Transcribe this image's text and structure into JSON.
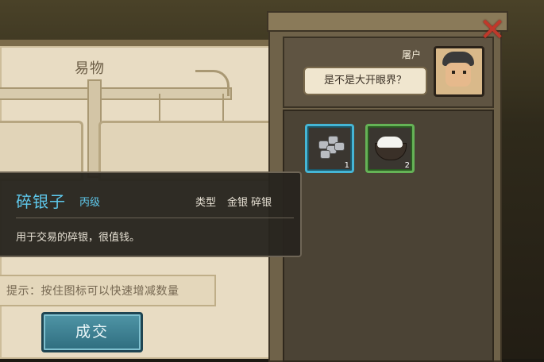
{
  "trade_panel": {
    "title": "易物",
    "hint": "提示：按住图标可以快速增减数量",
    "deal_button_label": "成交"
  },
  "shop": {
    "speaker_name": "屠户",
    "speech": "是不是大开眼界？",
    "slots": [
      {
        "item": "silver-icon",
        "count": "1",
        "border_color": "#45b6d6"
      },
      {
        "item": "rice-bowl-icon",
        "count": "2",
        "border_color": "#65b356"
      }
    ]
  },
  "tooltip": {
    "item_name": "碎银子",
    "grade": "丙级",
    "type_label": "类型",
    "type_value": "金银 碎银",
    "description": "用于交易的碎银，很值钱。"
  },
  "colors": {
    "accent_blue": "#5ec8ec",
    "close_red": "#c0392b"
  }
}
